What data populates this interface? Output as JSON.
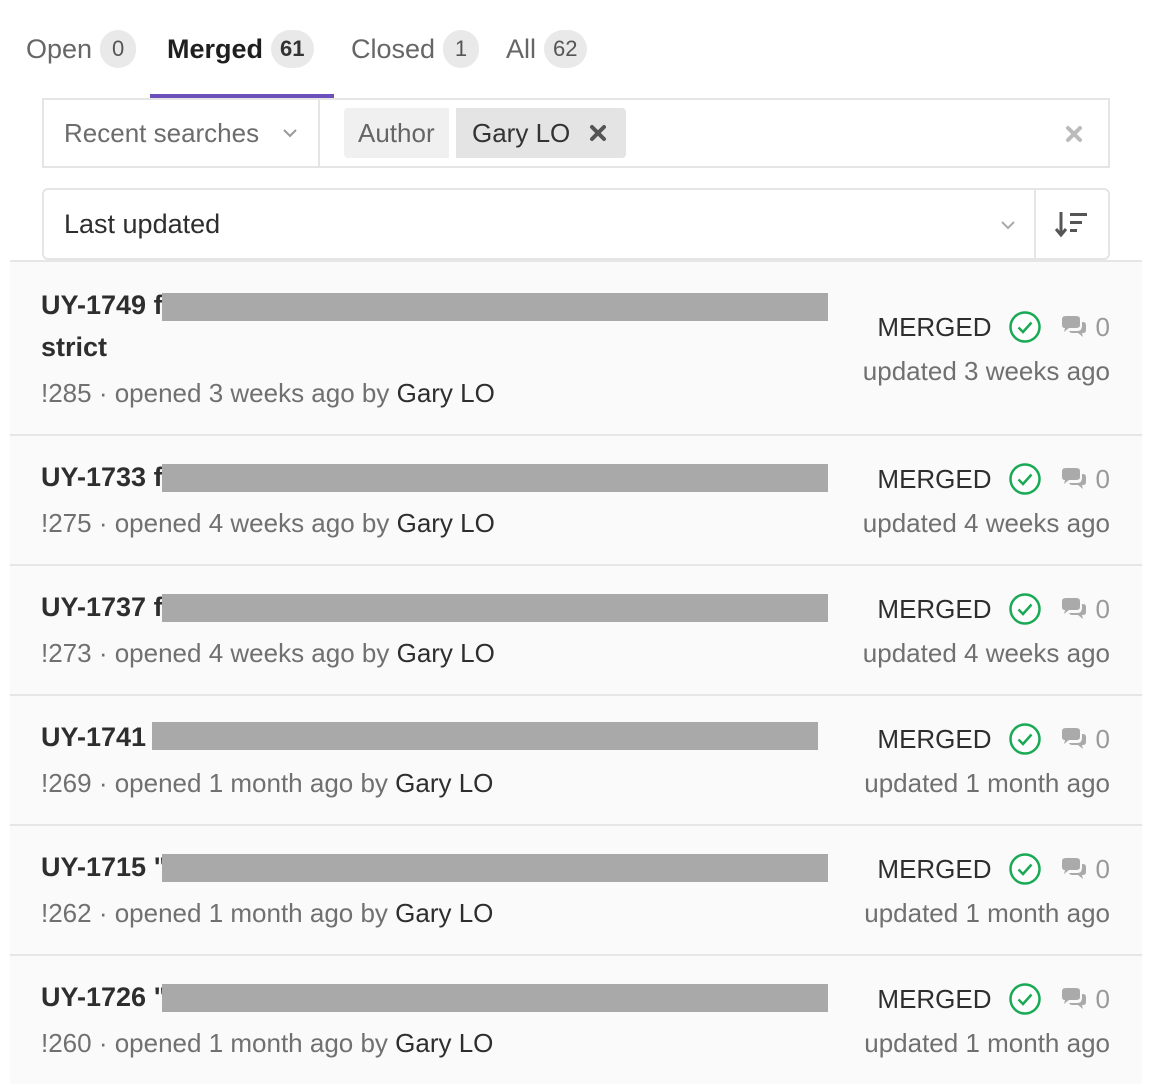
{
  "tabs": [
    {
      "label": "Open",
      "count": "0"
    },
    {
      "label": "Merged",
      "count": "61"
    },
    {
      "label": "Closed",
      "count": "1"
    },
    {
      "label": "All",
      "count": "62"
    }
  ],
  "active_tab": "Merged",
  "accent_color": "#6b4fbb",
  "filter": {
    "recent_searches_label": "Recent searches",
    "token_key": "Author",
    "token_value": "Gary LO"
  },
  "sort": {
    "label": "Last updated"
  },
  "merge_requests": [
    {
      "title": "UY-1749 f",
      "title_line2": "strict",
      "meta_prefix": "!285 · opened 3 weeks ago by ",
      "author": "Gary LO",
      "status": "MERGED",
      "comments": "0",
      "updated": "updated 3 weeks ago"
    },
    {
      "title": "UY-1733 f",
      "meta_prefix": "!275 · opened 4 weeks ago by ",
      "author": "Gary LO",
      "status": "MERGED",
      "comments": "0",
      "updated": "updated 4 weeks ago"
    },
    {
      "title": "UY-1737 f",
      "meta_prefix": "!273 · opened 4 weeks ago by ",
      "author": "Gary LO",
      "status": "MERGED",
      "comments": "0",
      "updated": "updated 4 weeks ago"
    },
    {
      "title": "UY-1741",
      "meta_prefix": "!269 · opened 1 month ago by ",
      "author": "Gary LO",
      "status": "MERGED",
      "comments": "0",
      "updated": "updated 1 month ago"
    },
    {
      "title": "UY-1715 \"",
      "meta_prefix": "!262 · opened 1 month ago by ",
      "author": "Gary LO",
      "status": "MERGED",
      "comments": "0",
      "updated": "updated 1 month ago"
    },
    {
      "title": "UY-1726 \"",
      "meta_prefix": "!260 · opened 1 month ago by ",
      "author": "Gary LO",
      "status": "MERGED",
      "comments": "0",
      "updated": "updated 1 month ago"
    }
  ]
}
